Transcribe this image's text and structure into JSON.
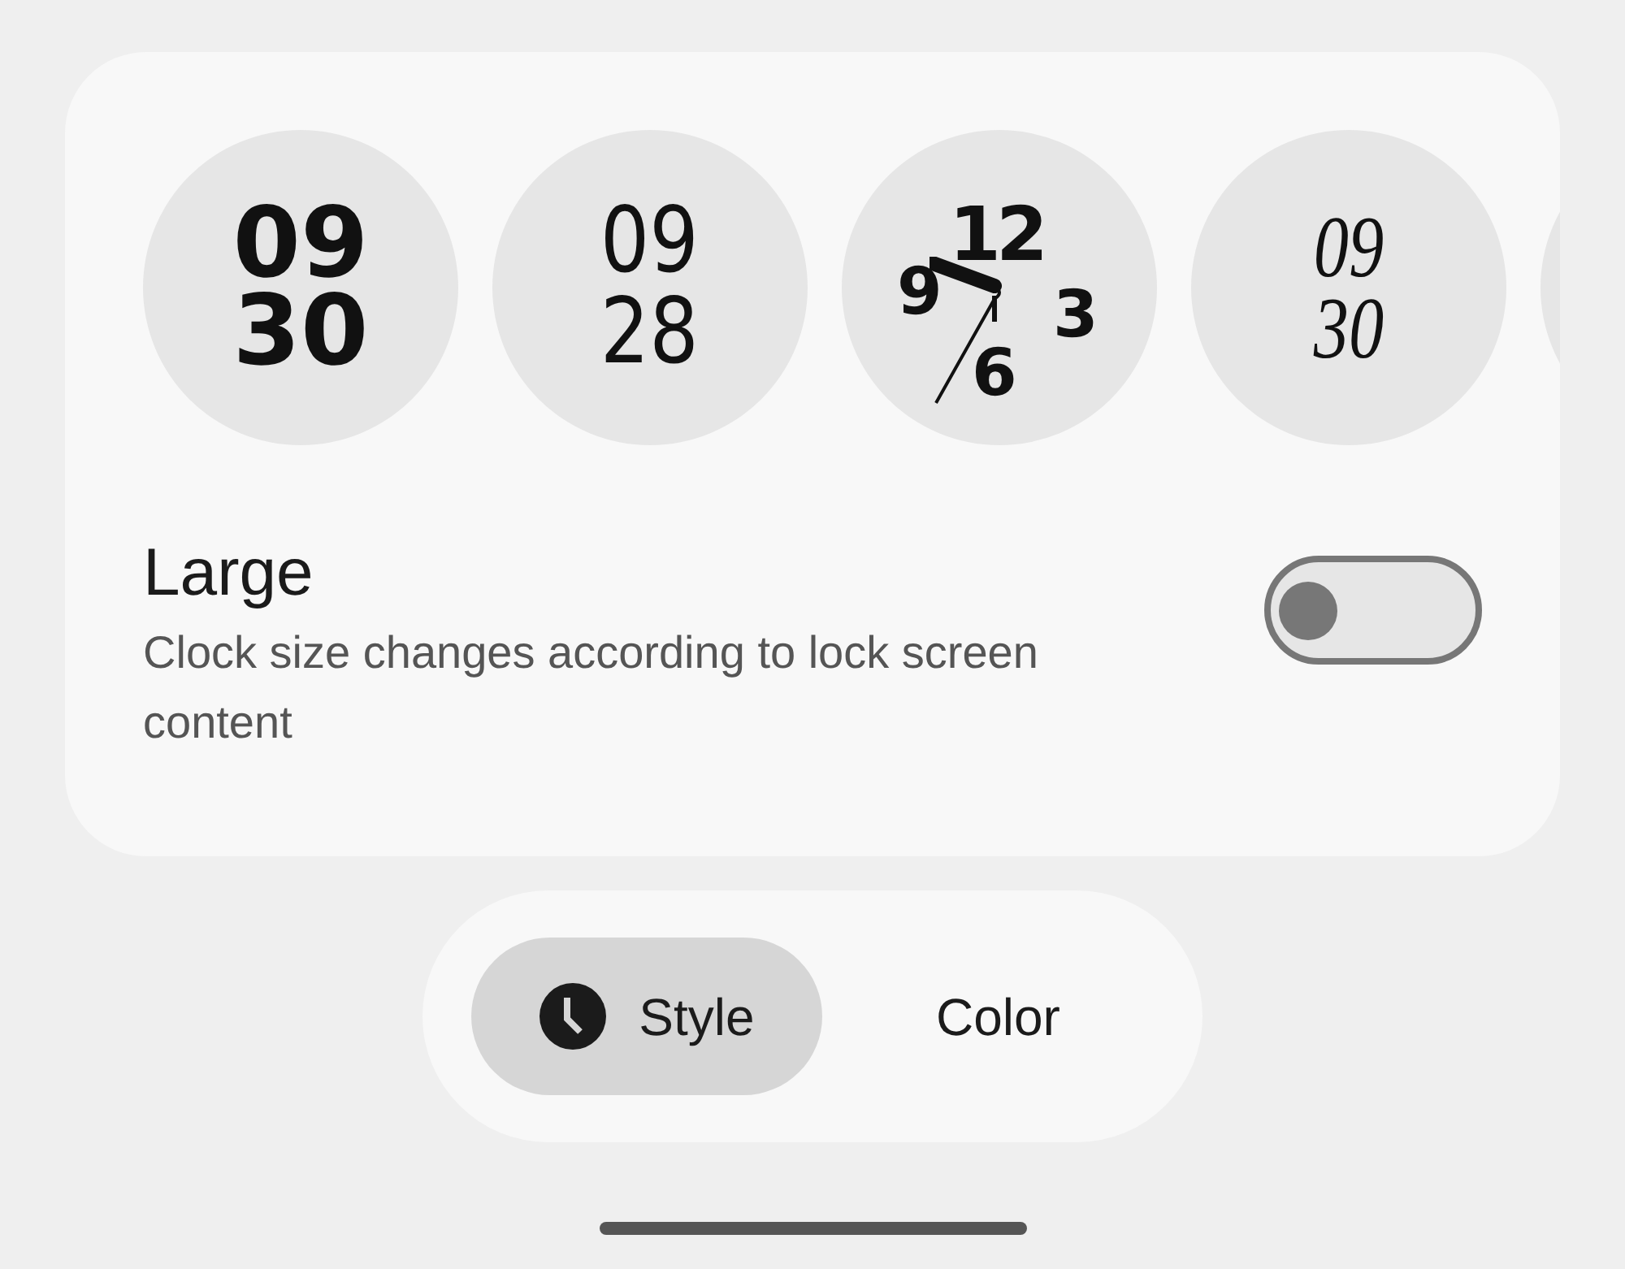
{
  "clock_faces": [
    {
      "kind": "bubble",
      "lines": [
        "09",
        "30"
      ]
    },
    {
      "kind": "thin",
      "lines": [
        "09",
        "28"
      ]
    },
    {
      "kind": "dial",
      "lines": [
        "12",
        "9",
        "3",
        "6"
      ]
    },
    {
      "kind": "serif",
      "lines": [
        "09",
        "30"
      ]
    },
    {
      "kind": "cut"
    }
  ],
  "size_setting": {
    "title": "Large",
    "description": "Clock size changes according to lock screen content",
    "on": false
  },
  "tabs": [
    {
      "label": "Style",
      "selected": true
    },
    {
      "label": "Color",
      "selected": false
    }
  ]
}
